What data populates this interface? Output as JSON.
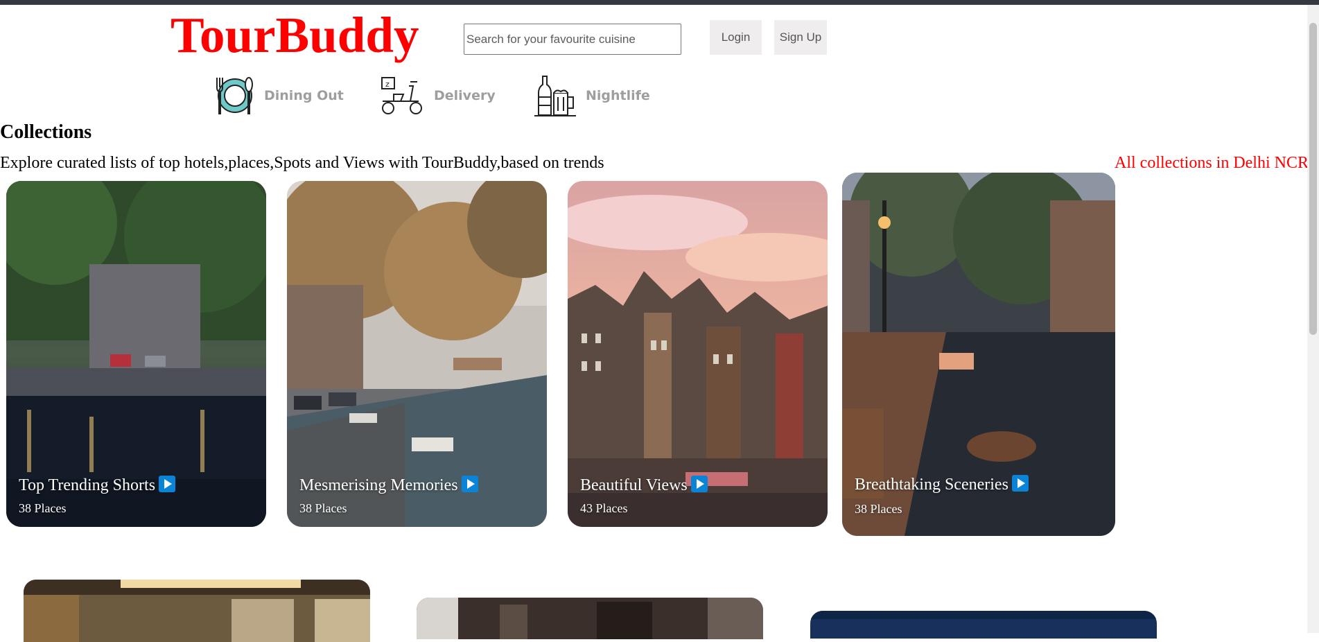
{
  "header": {
    "logo": "TourBuddy",
    "search_placeholder": "Search for your favourite cuisine",
    "login_label": "Login",
    "signup_label": "Sign Up"
  },
  "categories": [
    {
      "label": "Dining Out",
      "icon": "dining-icon"
    },
    {
      "label": "Delivery",
      "icon": "scooter-icon"
    },
    {
      "label": "Nightlife",
      "icon": "drinks-icon"
    }
  ],
  "collections": {
    "title": "Collections",
    "description": "Explore curated lists of top hotels,places,Spots and Views with TourBuddy,based on trends",
    "all_link": "All collections in Delhi NCR",
    "cards": [
      {
        "title": "Top Trending Shorts",
        "subtitle": "38 Places"
      },
      {
        "title": "Mesmerising Memories",
        "subtitle": "38 Places"
      },
      {
        "title": "Beautiful Views",
        "subtitle": "43 Places"
      },
      {
        "title": "Breathtaking Sceneries",
        "subtitle": "38 Places"
      }
    ]
  },
  "colors": {
    "brand": "#ff0000",
    "play_badge": "#0a84d6",
    "category_text": "#9e9e9e"
  }
}
